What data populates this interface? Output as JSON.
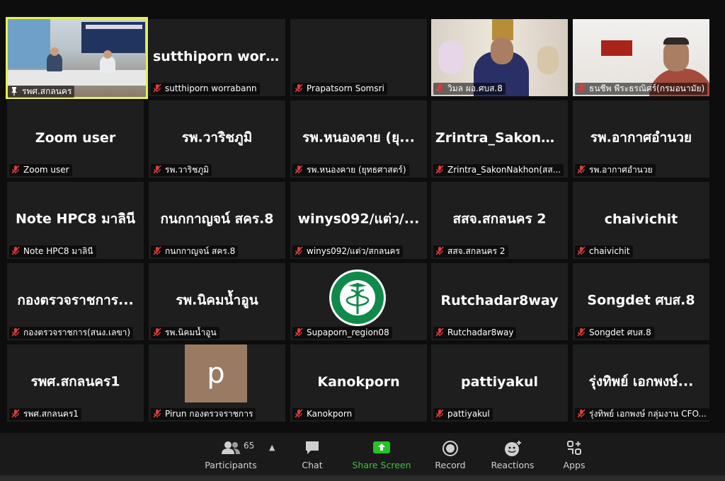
{
  "tiles": [
    {
      "big": "",
      "tag": "รพศ.สกลนคร",
      "kind": "video-room",
      "pinned": true
    },
    {
      "big": "sutthiporn  worr...",
      "tag": "sutthiporn worrabann"
    },
    {
      "big": "",
      "tag": "Prapatsorn Somsri"
    },
    {
      "big": "",
      "tag": "วิมล ผอ.ศบส.8",
      "kind": "video-man"
    },
    {
      "big": "",
      "tag": "ธนชีพ พีระธรณิศร์(กรมอนามัย)",
      "kind": "video-man2"
    },
    {
      "big": "Zoom user",
      "tag": "Zoom user"
    },
    {
      "big": "รพ.วาริชภูมิ",
      "tag": "รพ.วาริชภูมิ"
    },
    {
      "big": "รพ.หนองคาย (ยุ...",
      "tag": "รพ.หนองคาย (ยุทธศาสตร์)"
    },
    {
      "big": "Zrintra_SakonN...",
      "tag": "Zrintra_SakonNakhon(สส..."
    },
    {
      "big": "รพ.อากาศอำนวย",
      "tag": "รพ.อากาศอำนวย"
    },
    {
      "big": "Note  HPC8 มาลินี",
      "tag": "Note HPC8 มาลินี"
    },
    {
      "big": "กนกกาญจน์ สคร.8",
      "tag": "กนกกาญจน์ สคร.8"
    },
    {
      "big": "winys092/แต่ว/...",
      "tag": "winys092/แต่ว/สกลนคร"
    },
    {
      "big": "สสจ.สกลนคร 2",
      "tag": "สสจ.สกลนคร 2"
    },
    {
      "big": "chaivichit",
      "tag": "chaivichit"
    },
    {
      "big": "กองตรวจราชการ...",
      "tag": "กองตรวจราชการ(สนง.เลขา)"
    },
    {
      "big": "รพ.นิคมน้ำอูน",
      "tag": "รพ.นิคมน้ำอูน"
    },
    {
      "big": "",
      "tag": "Supaporn_region08",
      "kind": "logo"
    },
    {
      "big": "Rutchadar8way",
      "tag": "Rutchadar8way"
    },
    {
      "big": "Songdet ศบส.8",
      "tag": "Songdet ศบส.8"
    },
    {
      "big": "รพศ.สกลนคร1",
      "tag": "รพศ.สกลนคร1"
    },
    {
      "big": "",
      "tag": "Pirun กองตรวจราชการ",
      "kind": "avatar",
      "avatar": "p"
    },
    {
      "big": "Kanokporn",
      "tag": "Kanokporn"
    },
    {
      "big": "pattiyakul",
      "tag": "pattiyakul"
    },
    {
      "big": "รุ่งทิพย์ เอกพงษ์...",
      "tag": "รุ่งทิพย์ เอกพงษ์ กลุ่มงาน CFO..."
    }
  ],
  "toolbar": {
    "participants_label": "Participants",
    "participants_count": "65",
    "chat_label": "Chat",
    "share_label": "Share Screen",
    "record_label": "Record",
    "reactions_label": "Reactions",
    "apps_label": "Apps"
  },
  "colors": {
    "accent": "#3fc23f",
    "active_border": "#e5f24e",
    "mute": "#e03c3c",
    "tile_bg": "#1e1e1e"
  }
}
